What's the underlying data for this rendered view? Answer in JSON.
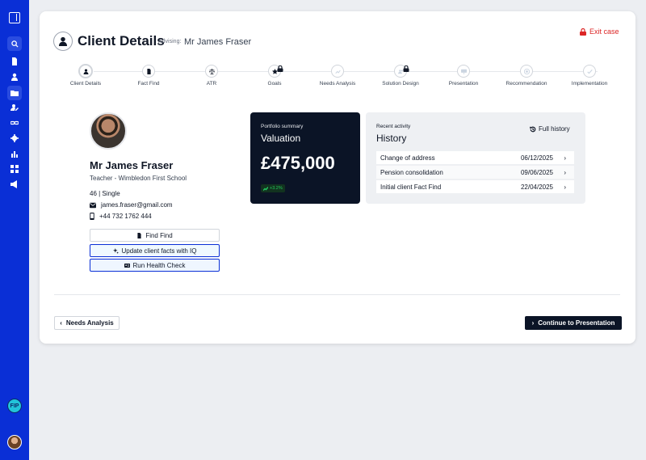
{
  "sidebar": {
    "items": [
      {
        "icon": "panel-toggle-icon"
      },
      {
        "icon": "search-icon"
      },
      {
        "icon": "document-icon"
      },
      {
        "icon": "user-icon"
      },
      {
        "icon": "folder-icon"
      },
      {
        "icon": "user-edit-icon"
      },
      {
        "icon": "link-icon"
      },
      {
        "icon": "gear-icon"
      },
      {
        "icon": "bar-chart-icon"
      },
      {
        "icon": "grid-icon"
      },
      {
        "icon": "megaphone-icon"
      }
    ],
    "badge_text": "FIP",
    "accent_color": "#0a2fd6"
  },
  "header": {
    "title": "Client Details",
    "advising_label": "Advising:",
    "advising_name": "Mr James Fraser",
    "exit_label": "Exit case",
    "exit_color": "#dc2626"
  },
  "stepper": {
    "steps": [
      {
        "label": "Client Details",
        "icon": "user-icon",
        "state": "current",
        "locked": false
      },
      {
        "label": "Fact Find",
        "icon": "document-icon",
        "state": "available",
        "locked": false
      },
      {
        "label": "ATR",
        "icon": "scale-icon",
        "state": "available",
        "locked": false
      },
      {
        "label": "Goals",
        "icon": "star-icon",
        "state": "available",
        "locked": true
      },
      {
        "label": "Needs Analysis",
        "icon": "chart-icon",
        "state": "disabled",
        "locked": false
      },
      {
        "label": "Solution Design",
        "icon": "users-icon",
        "state": "disabled",
        "locked": true
      },
      {
        "label": "Presentation",
        "icon": "presentation-icon",
        "state": "disabled",
        "locked": false
      },
      {
        "label": "Recommendation",
        "icon": "target-icon",
        "state": "disabled",
        "locked": false
      },
      {
        "label": "Implementation",
        "icon": "check-icon",
        "state": "disabled",
        "locked": false
      }
    ]
  },
  "client": {
    "name": "Mr James Fraser",
    "job": "Teacher - Wimbledon First School",
    "age_status": "46 | Single",
    "email": "james.fraser@gmail.com",
    "phone": "+44 732 1762 444"
  },
  "actions": {
    "find_find": "Find Find",
    "update_iq": "Update client facts with IQ",
    "health_check": "Run Health Check"
  },
  "portfolio": {
    "label": "Portfolio summary",
    "title": "Valuation",
    "value": "£475,000",
    "change": "+3.2%"
  },
  "history": {
    "label": "Recent activity",
    "title": "History",
    "full_link": "Full history",
    "rows": [
      {
        "text": "Change of address",
        "date": "06/12/2025"
      },
      {
        "text": "Pension consolidation",
        "date": "09/06/2025"
      },
      {
        "text": "Initial client Fact Find",
        "date": "22/04/2025"
      }
    ]
  },
  "footer": {
    "back_label": "Needs Analysis",
    "next_label": "Continue to Presentation"
  }
}
